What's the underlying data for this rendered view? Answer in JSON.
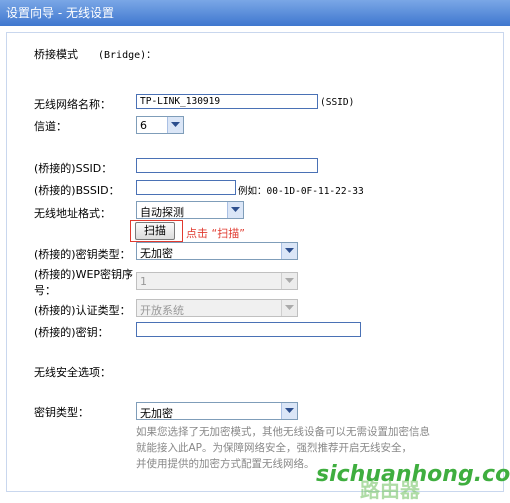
{
  "window": {
    "title": "设置向导 - 无线设置"
  },
  "bridge": {
    "label": "桥接模式",
    "mode": "(Bridge)："
  },
  "fields": {
    "ssid_name_label": "无线网络名称：",
    "ssid_name_value": "TP-LINK_130919",
    "ssid_suffix": "(SSID)",
    "channel_label": "信道：",
    "channel_value": "6",
    "bridged_ssid_label": "(桥接的)SSID：",
    "bridged_ssid_value": "",
    "bridged_bssid_label": "(桥接的)BSSID：",
    "bridged_bssid_value": "",
    "bssid_example": "例如：00-1D-0F-11-22-33",
    "addr_format_label": "无线地址格式：",
    "addr_format_value": "自动探测",
    "scan_button": "扫描",
    "scan_hint": "点击 “扫描”",
    "key_type_label": "(桥接的)密钥类型：",
    "key_type_value": "无加密",
    "wep_index_label_1": "(桥接的)WEP密钥序",
    "wep_index_label_2": "号：",
    "wep_index_value": "1",
    "auth_type_label": "(桥接的)认证类型：",
    "auth_type_value": "开放系统",
    "key_label": "(桥接的)密钥：",
    "key_value": ""
  },
  "security": {
    "heading": "无线安全选项：",
    "key_type_label": "密钥类型：",
    "key_type_value": "无加密",
    "note_1": "如果您选择了无加密模式，其他无线设备可以无需设置加密信息",
    "note_2": "就能接入此AP。为保障网络安全，强烈推荐开启无线安全，",
    "note_3": "并使用提供的加密方式配置无线网络。"
  },
  "watermark": {
    "text": "sichuanhong.com",
    "glyph": "路由器"
  },
  "colors": {
    "title_bar": "#3f77cf",
    "hint_red": "#e03a2f",
    "watermark_green": "#3fae3f"
  }
}
